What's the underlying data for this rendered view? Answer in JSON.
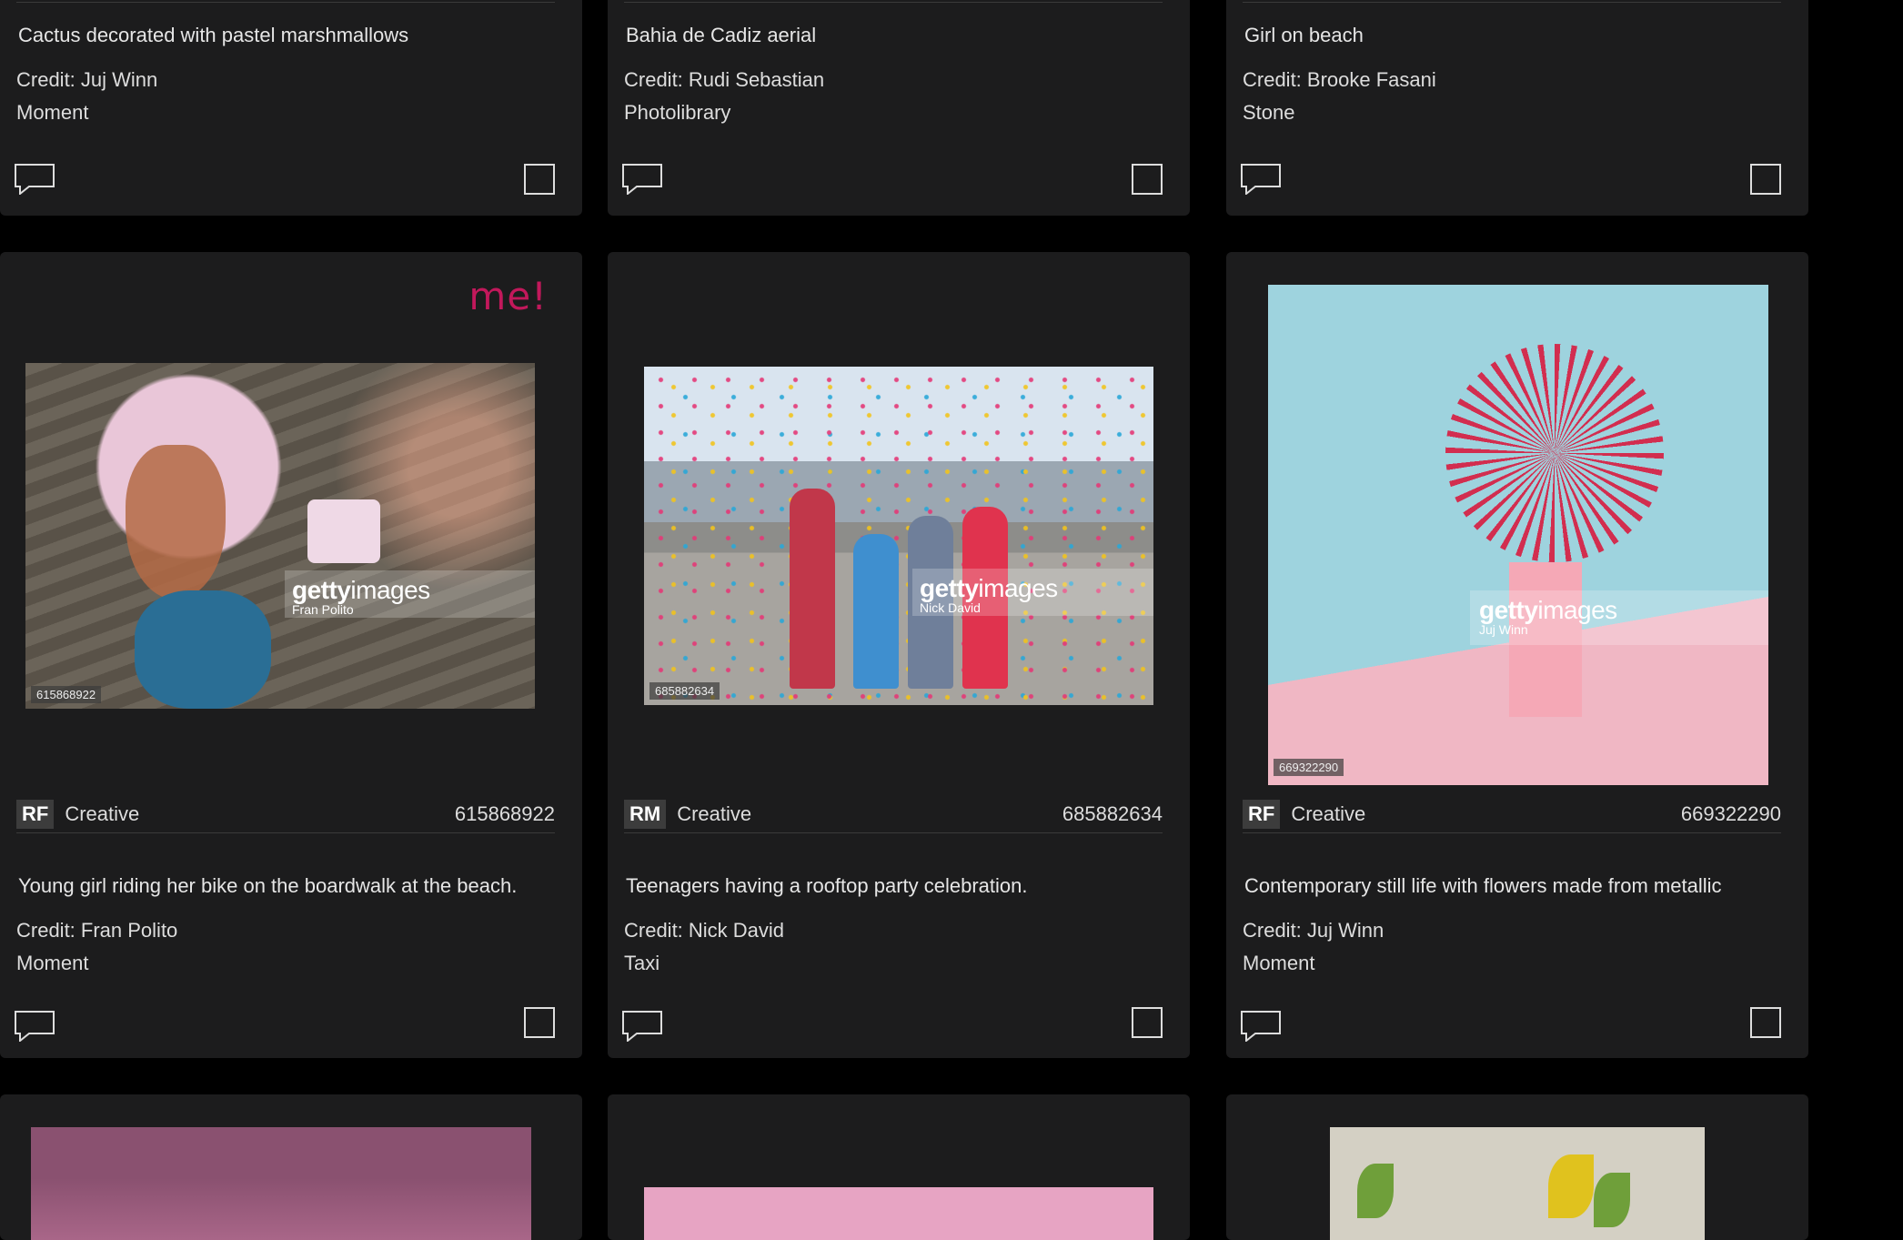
{
  "cards": [
    {
      "caption": "Cactus decorated with pastel marshmallows",
      "credit": "Credit: Juj Winn",
      "collection": "Moment"
    },
    {
      "caption": "Bahia de Cadiz aerial",
      "credit": "Credit: Rudi Sebastian",
      "collection": "Photolibrary"
    },
    {
      "caption": "Girl on beach",
      "credit": "Credit: Brooke Fasani",
      "collection": "Stone"
    },
    {
      "promo": "me!",
      "license": "RF",
      "content_type": "Creative",
      "image_id": "615868922",
      "watermark_brand": "getty",
      "watermark_brand2": "images",
      "watermark_credit": "Fran Polito",
      "caption": "Young girl riding her bike on the boardwalk at the beach.",
      "credit": "Credit: Fran Polito",
      "collection": "Moment"
    },
    {
      "license": "RM",
      "content_type": "Creative",
      "image_id": "685882634",
      "watermark_brand": "getty",
      "watermark_brand2": "images",
      "watermark_credit": "Nick David",
      "caption": "Teenagers having a rooftop party celebration.",
      "credit": "Credit: Nick David",
      "collection": "Taxi"
    },
    {
      "license": "RF",
      "content_type": "Creative",
      "image_id": "669322290",
      "watermark_brand": "getty",
      "watermark_brand2": "images",
      "watermark_credit": "Juj Winn",
      "caption": "Contemporary still life with flowers made from metallic",
      "credit": "Credit: Juj Winn",
      "collection": "Moment"
    }
  ],
  "icons": {
    "comment": "comment-icon",
    "select": "select-checkbox"
  },
  "colors": {
    "page_bg": "#000000",
    "card_bg": "#1c1c1d",
    "promo": "#c2185b"
  }
}
